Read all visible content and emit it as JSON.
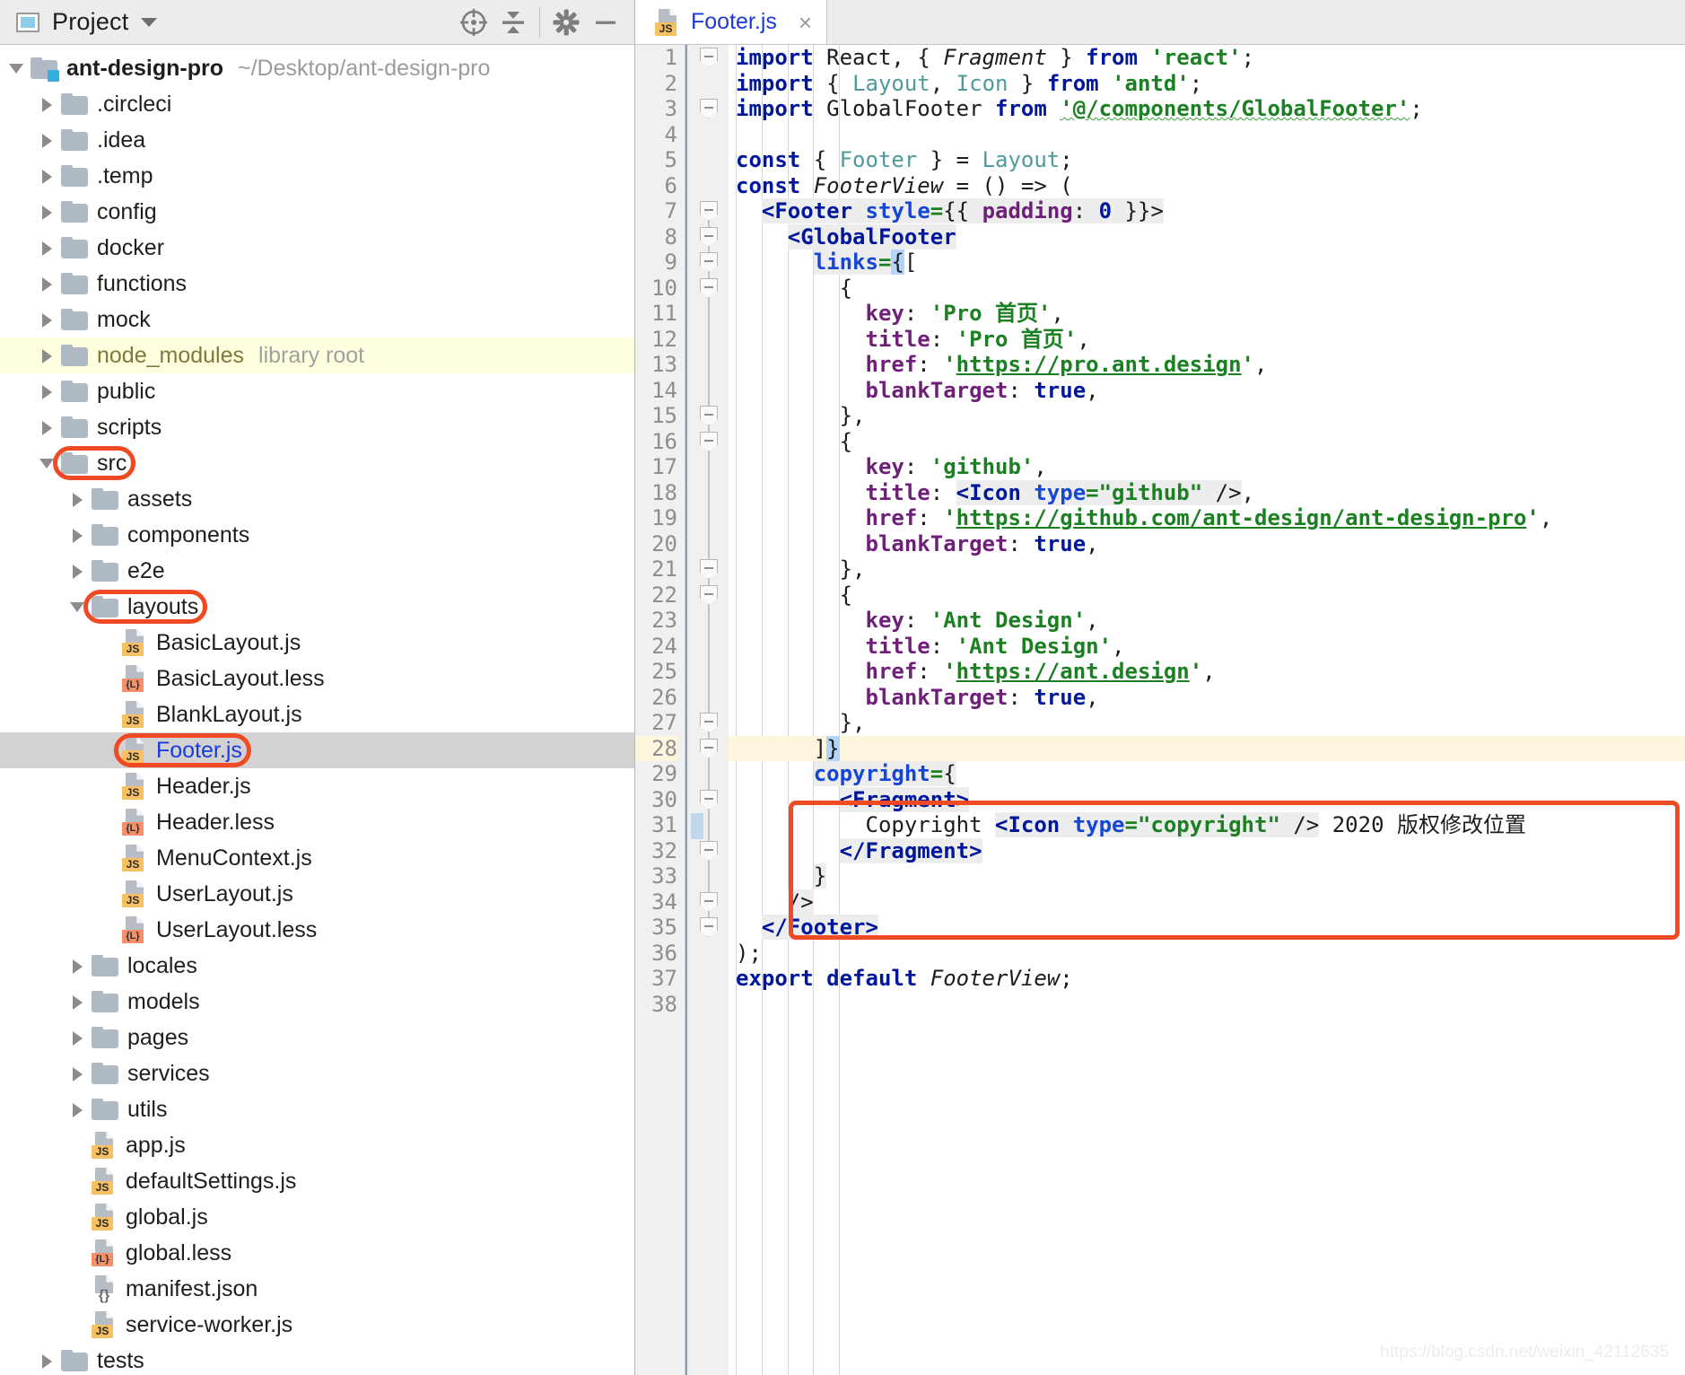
{
  "project_panel": {
    "title": "Project",
    "toolbar_icons": [
      "locate-icon",
      "collapse-all-icon",
      "settings-gear-icon",
      "minimize-icon"
    ],
    "root": {
      "label": "ant-design-pro",
      "path": "~/Desktop/ant-design-pro"
    },
    "tree": [
      {
        "label": ".circleci",
        "type": "folder",
        "depth": 1,
        "state": "collapsed"
      },
      {
        "label": ".idea",
        "type": "folder",
        "depth": 1,
        "state": "collapsed"
      },
      {
        "label": ".temp",
        "type": "folder",
        "depth": 1,
        "state": "collapsed"
      },
      {
        "label": "config",
        "type": "folder",
        "depth": 1,
        "state": "collapsed"
      },
      {
        "label": "docker",
        "type": "folder",
        "depth": 1,
        "state": "collapsed"
      },
      {
        "label": "functions",
        "type": "folder",
        "depth": 1,
        "state": "collapsed"
      },
      {
        "label": "mock",
        "type": "folder",
        "depth": 1,
        "state": "collapsed"
      },
      {
        "label": "node_modules",
        "type": "folder",
        "depth": 1,
        "state": "collapsed",
        "suffix": "library root",
        "highlight": "yellow"
      },
      {
        "label": "public",
        "type": "folder",
        "depth": 1,
        "state": "collapsed"
      },
      {
        "label": "scripts",
        "type": "folder",
        "depth": 1,
        "state": "collapsed"
      },
      {
        "label": "src",
        "type": "folder",
        "depth": 1,
        "state": "expanded",
        "annotated": true
      },
      {
        "label": "assets",
        "type": "folder",
        "depth": 2,
        "state": "collapsed"
      },
      {
        "label": "components",
        "type": "folder",
        "depth": 2,
        "state": "collapsed"
      },
      {
        "label": "e2e",
        "type": "folder",
        "depth": 2,
        "state": "collapsed"
      },
      {
        "label": "layouts",
        "type": "folder",
        "depth": 2,
        "state": "expanded",
        "annotated": true
      },
      {
        "label": "BasicLayout.js",
        "type": "js",
        "depth": 3
      },
      {
        "label": "BasicLayout.less",
        "type": "less",
        "depth": 3
      },
      {
        "label": "BlankLayout.js",
        "type": "js",
        "depth": 3
      },
      {
        "label": "Footer.js",
        "type": "js",
        "depth": 3,
        "selected": true,
        "annotated": true
      },
      {
        "label": "Header.js",
        "type": "js",
        "depth": 3
      },
      {
        "label": "Header.less",
        "type": "less",
        "depth": 3
      },
      {
        "label": "MenuContext.js",
        "type": "js",
        "depth": 3
      },
      {
        "label": "UserLayout.js",
        "type": "js",
        "depth": 3
      },
      {
        "label": "UserLayout.less",
        "type": "less",
        "depth": 3
      },
      {
        "label": "locales",
        "type": "folder",
        "depth": 2,
        "state": "collapsed"
      },
      {
        "label": "models",
        "type": "folder",
        "depth": 2,
        "state": "collapsed"
      },
      {
        "label": "pages",
        "type": "folder",
        "depth": 2,
        "state": "collapsed"
      },
      {
        "label": "services",
        "type": "folder",
        "depth": 2,
        "state": "collapsed"
      },
      {
        "label": "utils",
        "type": "folder",
        "depth": 2,
        "state": "collapsed"
      },
      {
        "label": "app.js",
        "type": "js",
        "depth": 2
      },
      {
        "label": "defaultSettings.js",
        "type": "js",
        "depth": 2
      },
      {
        "label": "global.js",
        "type": "js",
        "depth": 2
      },
      {
        "label": "global.less",
        "type": "less",
        "depth": 2
      },
      {
        "label": "manifest.json",
        "type": "json",
        "depth": 2
      },
      {
        "label": "service-worker.js",
        "type": "js",
        "depth": 2
      },
      {
        "label": "tests",
        "type": "folder",
        "depth": 1,
        "state": "collapsed"
      }
    ]
  },
  "editor": {
    "tab": {
      "label": "Footer.js",
      "icon": "js-file-icon",
      "close": "×"
    },
    "current_line": 28,
    "total_lines": 38,
    "lines": [
      {
        "n": 1,
        "html": "<span class=\"kw\">import</span><span class=\"plain\"> React, { </span><span class=\"ital\">Fragment</span><span class=\"plain\"> } </span><span class=\"kw\">from</span><span class=\"plain\"> </span><span class=\"str\">'react'</span><span class=\"plain\">;</span>"
      },
      {
        "n": 2,
        "html": "<span class=\"kw\">import</span><span class=\"plain\"> { </span><span class=\"cyan\">Layout</span><span class=\"plain\">, </span><span class=\"cyan\">Icon</span><span class=\"plain\"> } </span><span class=\"kw\">from</span><span class=\"plain\"> </span><span class=\"str\">'antd'</span><span class=\"plain\">;</span>"
      },
      {
        "n": 3,
        "html": "<span class=\"kw\">import</span><span class=\"plain\"> GlobalFooter </span><span class=\"kw\">from</span><span class=\"plain\"> </span><span class=\"str wavy\">'@/components/GlobalFooter'</span><span class=\"plain\">;</span>"
      },
      {
        "n": 4,
        "html": ""
      },
      {
        "n": 5,
        "html": "<span class=\"kw\">const</span><span class=\"plain\"> { </span><span class=\"cyan\">Footer</span><span class=\"plain\"> } = </span><span class=\"cyan\">Layout</span><span class=\"plain\">;</span>"
      },
      {
        "n": 6,
        "html": "<span class=\"kw\">const</span><span class=\"plain\"> </span><span class=\"ital\">FooterView</span><span class=\"plain\"> = () =&gt; (</span>"
      },
      {
        "n": 7,
        "html": "  <span class=\"tag2 hlbg\">&lt;Footer</span><span class=\"plain hlbg\"> </span><span class=\"attr hlbg\">style</span><span class=\"eq hlbg\">=</span><span class=\"plain hlbg\">{{ </span><span class=\"prop hlbg\">padding</span><span class=\"plain hlbg\">: </span><span class=\"num hlbg\">0</span><span class=\"plain hlbg\"> }}&gt;</span>"
      },
      {
        "n": 8,
        "html": "    <span class=\"tag2 hlbg\">&lt;GlobalFooter</span>"
      },
      {
        "n": 9,
        "html": "      <span class=\"attr hlbg\">links</span><span class=\"eq hlbg\">=</span><span class=\"plain selbg\">{</span><span class=\"plain\">[</span>"
      },
      {
        "n": 10,
        "html": "        <span class=\"plain\">{</span>"
      },
      {
        "n": 11,
        "html": "          <span class=\"prop\">key</span><span class=\"plain\">: </span><span class=\"str\">'Pro 首页'</span><span class=\"plain\">,</span>"
      },
      {
        "n": 12,
        "html": "          <span class=\"prop\">title</span><span class=\"plain\">: </span><span class=\"str\">'Pro 首页'</span><span class=\"plain\">,</span>"
      },
      {
        "n": 13,
        "html": "          <span class=\"prop\">href</span><span class=\"plain\">: </span><span class=\"str\">'</span><span class=\"strp\">https://pro.ant.design</span><span class=\"str\">'</span><span class=\"plain\">,</span>"
      },
      {
        "n": 14,
        "html": "          <span class=\"prop\">blankTarget</span><span class=\"plain\">: </span><span class=\"kw\">true</span><span class=\"plain\">,</span>"
      },
      {
        "n": 15,
        "html": "        <span class=\"plain\">},</span>"
      },
      {
        "n": 16,
        "html": "        <span class=\"plain\">{</span>"
      },
      {
        "n": 17,
        "html": "          <span class=\"prop\">key</span><span class=\"plain\">: </span><span class=\"str\">'github'</span><span class=\"plain\">,</span>"
      },
      {
        "n": 18,
        "html": "          <span class=\"prop\">title</span><span class=\"plain\">: </span><span class=\"tag2 hlbg\">&lt;Icon</span><span class=\"plain hlbg\"> </span><span class=\"attr hlbg\">type</span><span class=\"eq hlbg\">=</span><span class=\"str hlbg\">\"github\"</span><span class=\"plain hlbg\"> /&gt;</span><span class=\"plain\">,</span>"
      },
      {
        "n": 19,
        "html": "          <span class=\"prop\">href</span><span class=\"plain\">: </span><span class=\"str\">'</span><span class=\"strp\">https://github.com/ant-design/ant-design-pro</span><span class=\"str\">'</span><span class=\"plain\">,</span>"
      },
      {
        "n": 20,
        "html": "          <span class=\"prop\">blankTarget</span><span class=\"plain\">: </span><span class=\"kw\">true</span><span class=\"plain\">,</span>"
      },
      {
        "n": 21,
        "html": "        <span class=\"plain\">},</span>"
      },
      {
        "n": 22,
        "html": "        <span class=\"plain\">{</span>"
      },
      {
        "n": 23,
        "html": "          <span class=\"prop\">key</span><span class=\"plain\">: </span><span class=\"str\">'Ant Design'</span><span class=\"plain\">,</span>"
      },
      {
        "n": 24,
        "html": "          <span class=\"prop\">title</span><span class=\"plain\">: </span><span class=\"str\">'Ant Design'</span><span class=\"plain\">,</span>"
      },
      {
        "n": 25,
        "html": "          <span class=\"prop\">href</span><span class=\"plain\">: </span><span class=\"str\">'</span><span class=\"strp\">https://ant.design</span><span class=\"str\">'</span><span class=\"plain\">,</span>"
      },
      {
        "n": 26,
        "html": "          <span class=\"prop\">blankTarget</span><span class=\"plain\">: </span><span class=\"kw\">true</span><span class=\"plain\">,</span>"
      },
      {
        "n": 27,
        "html": "        <span class=\"plain\">},</span>"
      },
      {
        "n": 28,
        "html": "      <span class=\"plain\">]</span><span class=\"plain selbg\">}</span>"
      },
      {
        "n": 29,
        "html": "      <span class=\"attr hlbg\">copyright</span><span class=\"eq hlbg\">=</span><span class=\"plain hlbg\">{</span>"
      },
      {
        "n": 30,
        "html": "        <span class=\"tag2 hlbg\">&lt;Fragment&gt;</span>"
      },
      {
        "n": 31,
        "html": "          <span class=\"plain\">Copyright </span><span class=\"tag2 hlbg\">&lt;Icon</span><span class=\"plain hlbg\"> </span><span class=\"attr hlbg\">type</span><span class=\"eq hlbg\">=</span><span class=\"str hlbg\">\"copyright\"</span><span class=\"plain hlbg\"> /&gt;</span><span class=\"plain\"> 2020 版权修改位置</span>"
      },
      {
        "n": 32,
        "html": "        <span class=\"tag2 hlbg\">&lt;/Fragment&gt;</span>"
      },
      {
        "n": 33,
        "html": "      <span class=\"plain hlbg\">}</span>"
      },
      {
        "n": 34,
        "html": "    <span class=\"plain hlbg\">/&gt;</span>"
      },
      {
        "n": 35,
        "html": "  <span class=\"tag2 hlbg\">&lt;/Footer&gt;</span>"
      },
      {
        "n": 36,
        "html": "<span class=\"plain\">);</span>"
      },
      {
        "n": 37,
        "html": "<span class=\"kw\">export default</span><span class=\"plain\"> </span><span class=\"ital\">FooterView</span><span class=\"plain\">;</span>"
      },
      {
        "n": 38,
        "html": ""
      }
    ],
    "annotation_label": "copyright-block-highlight"
  },
  "watermark": "https://blog.csdn.net/weixin_42112635"
}
